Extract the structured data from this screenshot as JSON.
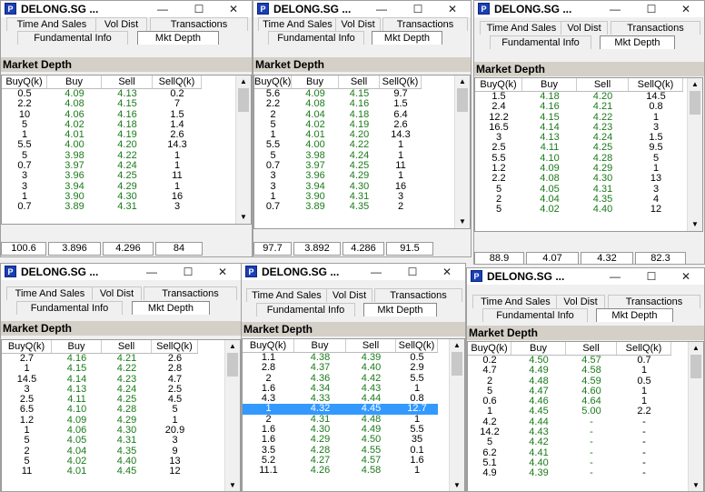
{
  "common": {
    "title": "DELONG.SG ...",
    "icon_letter": "P",
    "minimize_glyph": "—",
    "maximize_glyph": "☐",
    "close_glyph": "✕",
    "tabs": {
      "time_and_sales": "Time And Sales",
      "vol_dist": "Vol Dist",
      "transactions": "Transactions",
      "fundamental_info": "Fundamental Info",
      "mkt_depth": "Mkt Depth"
    },
    "section_title": "Market Depth",
    "columns": [
      "BuyQ(k)",
      "Buy",
      "Sell",
      "SellQ(k)"
    ],
    "scroll_up": "▲",
    "scroll_down": "▼"
  },
  "windows": [
    {
      "rows": [
        [
          "0.5",
          "4.09",
          "4.13",
          "0.2"
        ],
        [
          "2.2",
          "4.08",
          "4.15",
          "7"
        ],
        [
          "10",
          "4.06",
          "4.16",
          "1.5"
        ],
        [
          "5",
          "4.02",
          "4.18",
          "1.4"
        ],
        [
          "1",
          "4.01",
          "4.19",
          "2.6"
        ],
        [
          "5.5",
          "4.00",
          "4.20",
          "14.3"
        ],
        [
          "5",
          "3.98",
          "4.22",
          "1"
        ],
        [
          "0.7",
          "3.97",
          "4.24",
          "1"
        ],
        [
          "3",
          "3.96",
          "4.25",
          "11"
        ],
        [
          "3",
          "3.94",
          "4.29",
          "1"
        ],
        [
          "1",
          "3.90",
          "4.30",
          "16"
        ],
        [
          "0.7",
          "3.89",
          "4.31",
          "3"
        ]
      ],
      "totals": [
        "100.6",
        "3.896",
        "4.296",
        "84"
      ]
    },
    {
      "rows": [
        [
          "5.6",
          "4.09",
          "4.15",
          "9.7"
        ],
        [
          "2.2",
          "4.08",
          "4.16",
          "1.5"
        ],
        [
          "2",
          "4.04",
          "4.18",
          "6.4"
        ],
        [
          "5",
          "4.02",
          "4.19",
          "2.6"
        ],
        [
          "1",
          "4.01",
          "4.20",
          "14.3"
        ],
        [
          "5.5",
          "4.00",
          "4.22",
          "1"
        ],
        [
          "5",
          "3.98",
          "4.24",
          "1"
        ],
        [
          "0.7",
          "3.97",
          "4.25",
          "11"
        ],
        [
          "3",
          "3.96",
          "4.29",
          "1"
        ],
        [
          "3",
          "3.94",
          "4.30",
          "16"
        ],
        [
          "1",
          "3.90",
          "4.31",
          "3"
        ],
        [
          "0.7",
          "3.89",
          "4.35",
          "2"
        ]
      ],
      "totals": [
        "97.7",
        "3.892",
        "4.286",
        "91.5"
      ]
    },
    {
      "rows": [
        [
          "1.5",
          "4.18",
          "4.20",
          "14.5"
        ],
        [
          "2.4",
          "4.16",
          "4.21",
          "0.8"
        ],
        [
          "12.2",
          "4.15",
          "4.22",
          "1"
        ],
        [
          "16.5",
          "4.14",
          "4.23",
          "3"
        ],
        [
          "3",
          "4.13",
          "4.24",
          "1.5"
        ],
        [
          "2.5",
          "4.11",
          "4.25",
          "9.5"
        ],
        [
          "5.5",
          "4.10",
          "4.28",
          "5"
        ],
        [
          "1.2",
          "4.09",
          "4.29",
          "1"
        ],
        [
          "2.2",
          "4.08",
          "4.30",
          "13"
        ],
        [
          "5",
          "4.05",
          "4.31",
          "3"
        ],
        [
          "2",
          "4.04",
          "4.35",
          "4"
        ],
        [
          "5",
          "4.02",
          "4.40",
          "12"
        ]
      ],
      "totals": [
        "88.9",
        "4.07",
        "4.32",
        "82.3"
      ]
    },
    {
      "rows": [
        [
          "2.7",
          "4.16",
          "4.21",
          "2.6"
        ],
        [
          "1",
          "4.15",
          "4.22",
          "2.8"
        ],
        [
          "14.5",
          "4.14",
          "4.23",
          "4.7"
        ],
        [
          "3",
          "4.13",
          "4.24",
          "2.5"
        ],
        [
          "2.5",
          "4.11",
          "4.25",
          "4.5"
        ],
        [
          "6.5",
          "4.10",
          "4.28",
          "5"
        ],
        [
          "1.2",
          "4.09",
          "4.29",
          "1"
        ],
        [
          "1",
          "4.06",
          "4.30",
          "20.9"
        ],
        [
          "5",
          "4.05",
          "4.31",
          "3"
        ],
        [
          "2",
          "4.04",
          "4.35",
          "9"
        ],
        [
          "5",
          "4.02",
          "4.40",
          "13"
        ],
        [
          "11",
          "4.01",
          "4.45",
          "12"
        ]
      ]
    },
    {
      "selected_row": 6,
      "rows": [
        [
          "1.1",
          "4.38",
          "4.39",
          "0.5"
        ],
        [
          "2.8",
          "4.37",
          "4.40",
          "2.9"
        ],
        [
          "2",
          "4.36",
          "4.42",
          "5.5"
        ],
        [
          "1.6",
          "4.34",
          "4.43",
          "1"
        ],
        [
          "4.3",
          "4.33",
          "4.44",
          "0.8"
        ],
        [
          "1",
          "4.32",
          "4.45",
          "12.7"
        ],
        [
          "2",
          "4.31",
          "4.48",
          "1"
        ],
        [
          "1.6",
          "4.30",
          "4.49",
          "5.5"
        ],
        [
          "1.6",
          "4.29",
          "4.50",
          "35"
        ],
        [
          "3.5",
          "4.28",
          "4.55",
          "0.1"
        ],
        [
          "5.2",
          "4.27",
          "4.57",
          "1.6"
        ],
        [
          "11.1",
          "4.26",
          "4.58",
          "1"
        ]
      ]
    },
    {
      "rows": [
        [
          "0.2",
          "4.50",
          "4.57",
          "0.7"
        ],
        [
          "4.7",
          "4.49",
          "4.58",
          "1"
        ],
        [
          "2",
          "4.48",
          "4.59",
          "0.5"
        ],
        [
          "5",
          "4.47",
          "4.60",
          "1"
        ],
        [
          "0.6",
          "4.46",
          "4.64",
          "1"
        ],
        [
          "1",
          "4.45",
          "5.00",
          "2.2"
        ],
        [
          "4.2",
          "4.44",
          "-",
          "-"
        ],
        [
          "14.2",
          "4.43",
          "-",
          "-"
        ],
        [
          "5",
          "4.42",
          "-",
          "-"
        ],
        [
          "6.2",
          "4.41",
          "-",
          "-"
        ],
        [
          "5.1",
          "4.40",
          "-",
          "-"
        ],
        [
          "4.9",
          "4.39",
          "-",
          "-"
        ]
      ]
    }
  ]
}
